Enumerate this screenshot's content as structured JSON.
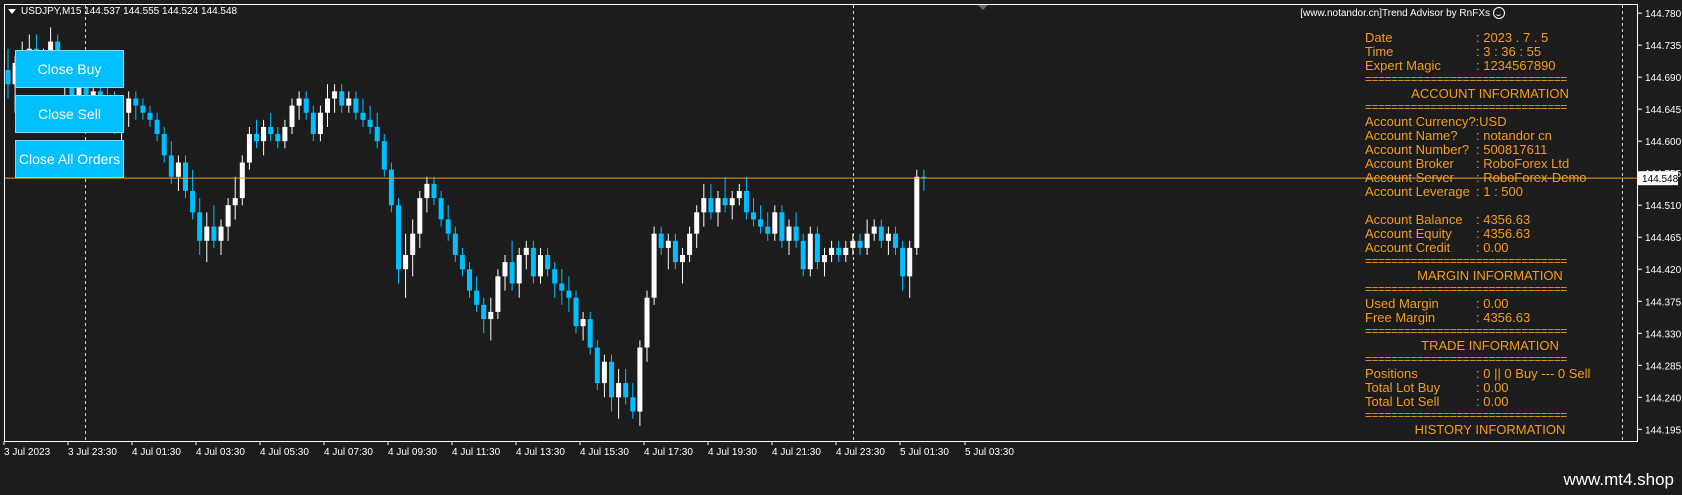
{
  "symbol_info": "USDJPY,M15  144.537 144.555 144.524 144.548",
  "ea_label": "[www.notandor.cn]Trend Advisor by RnFXs",
  "buttons": {
    "close_buy": "Close Buy",
    "close_sell": "Close Sell",
    "close_all": "Close All Orders"
  },
  "price_axis": [
    "144.780",
    "144.735",
    "144.690",
    "144.645",
    "144.600",
    "144.555",
    "144.510",
    "144.465",
    "144.420",
    "144.375",
    "144.330",
    "144.285",
    "144.240",
    "144.195"
  ],
  "current_price": "144.548",
  "time_axis": [
    "3 Jul 2023",
    "3 Jul 23:30",
    "4 Jul 01:30",
    "4 Jul 03:30",
    "4 Jul 05:30",
    "4 Jul 07:30",
    "4 Jul 09:30",
    "4 Jul 11:30",
    "4 Jul 13:30",
    "4 Jul 15:30",
    "4 Jul 17:30",
    "4 Jul 19:30",
    "4 Jul 21:30",
    "4 Jul 23:30",
    "5 Jul 01:30",
    "5 Jul 03:30"
  ],
  "panel": {
    "date_key": "Date",
    "date_val": ": 2023 . 7 . 5",
    "time_key": "Time",
    "time_val": ": 3 : 36 : 55",
    "magic_key": "Expert Magic",
    "magic_val": ": 1234567890",
    "separator": "===============================",
    "account_header": "ACCOUNT INFORMATION",
    "currency_key": "Account Currency?:",
    "currency_val": " USD",
    "name_key": "Account Name?",
    "name_val": ": notandor cn",
    "number_key": "Account Number?",
    "number_val": ": 500817611",
    "broker_key": "Account Broker",
    "broker_val": ": RoboForex Ltd",
    "server_key": "Account Server",
    "server_val": ": RoboForex-Demo",
    "leverage_key": "Account Leverage",
    "leverage_val": ": 1 : 500",
    "balance_key": "Account Balance",
    "balance_val": ": 4356.63",
    "equity_key": "Account Equity",
    "equity_val": ": 4356.63",
    "credit_key": "Account Credit",
    "credit_val": ": 0.00",
    "margin_header": "MARGIN INFORMATION",
    "used_margin_key": "Used Margin",
    "used_margin_val": ": 0.00",
    "free_margin_key": "Free Margin",
    "free_margin_val": ": 4356.63",
    "trade_header": "TRADE INFORMATION",
    "positions_key": "Positions",
    "positions_val": ": 0  ||  0 Buy --- 0 Sell",
    "lot_buy_key": "Total Lot Buy",
    "lot_buy_val": ": 0.00",
    "lot_sell_key": "Total Lot Sell",
    "lot_sell_val": ": 0.00",
    "history_header": "HISTORY INFORMATION"
  },
  "brand": "www.mt4.shop",
  "colors": {
    "background": "#1c1c1c",
    "bull": "#ffffff",
    "bear": "#00bfff",
    "price_line": "#f29c1f",
    "panel_text": "#f29c1f",
    "button": "#00bfff"
  },
  "chart_data": {
    "type": "candlestick",
    "y_range": [
      144.18,
      144.79
    ],
    "candles": [
      {
        "o": 144.7,
        "h": 144.73,
        "l": 144.66,
        "c": 144.68
      },
      {
        "o": 144.68,
        "h": 144.72,
        "l": 144.64,
        "c": 144.71
      },
      {
        "o": 144.71,
        "h": 144.74,
        "l": 144.68,
        "c": 144.72
      },
      {
        "o": 144.72,
        "h": 144.75,
        "l": 144.7,
        "c": 144.73
      },
      {
        "o": 144.73,
        "h": 144.75,
        "l": 144.69,
        "c": 144.7
      },
      {
        "o": 144.7,
        "h": 144.73,
        "l": 144.68,
        "c": 144.72
      },
      {
        "o": 144.72,
        "h": 144.76,
        "l": 144.7,
        "c": 144.74
      },
      {
        "o": 144.74,
        "h": 144.75,
        "l": 144.68,
        "c": 144.69
      },
      {
        "o": 144.69,
        "h": 144.72,
        "l": 144.66,
        "c": 144.7
      },
      {
        "o": 144.7,
        "h": 144.72,
        "l": 144.64,
        "c": 144.65
      },
      {
        "o": 144.65,
        "h": 144.7,
        "l": 144.63,
        "c": 144.68
      },
      {
        "o": 144.68,
        "h": 144.71,
        "l": 144.64,
        "c": 144.66
      },
      {
        "o": 144.66,
        "h": 144.69,
        "l": 144.64,
        "c": 144.67
      },
      {
        "o": 144.67,
        "h": 144.69,
        "l": 144.65,
        "c": 144.66
      },
      {
        "o": 144.66,
        "h": 144.68,
        "l": 144.63,
        "c": 144.65
      },
      {
        "o": 144.65,
        "h": 144.67,
        "l": 144.61,
        "c": 144.62
      },
      {
        "o": 144.62,
        "h": 144.66,
        "l": 144.6,
        "c": 144.64
      },
      {
        "o": 144.64,
        "h": 144.67,
        "l": 144.62,
        "c": 144.66
      },
      {
        "o": 144.66,
        "h": 144.67,
        "l": 144.63,
        "c": 144.65
      },
      {
        "o": 144.65,
        "h": 144.66,
        "l": 144.63,
        "c": 144.64
      },
      {
        "o": 144.64,
        "h": 144.65,
        "l": 144.62,
        "c": 144.63
      },
      {
        "o": 144.63,
        "h": 144.64,
        "l": 144.6,
        "c": 144.61
      },
      {
        "o": 144.61,
        "h": 144.62,
        "l": 144.57,
        "c": 144.58
      },
      {
        "o": 144.58,
        "h": 144.6,
        "l": 144.54,
        "c": 144.55
      },
      {
        "o": 144.55,
        "h": 144.58,
        "l": 144.53,
        "c": 144.57
      },
      {
        "o": 144.57,
        "h": 144.58,
        "l": 144.52,
        "c": 144.53
      },
      {
        "o": 144.53,
        "h": 144.56,
        "l": 144.49,
        "c": 144.5
      },
      {
        "o": 144.5,
        "h": 144.52,
        "l": 144.44,
        "c": 144.46
      },
      {
        "o": 144.46,
        "h": 144.5,
        "l": 144.43,
        "c": 144.48
      },
      {
        "o": 144.48,
        "h": 144.51,
        "l": 144.45,
        "c": 144.46
      },
      {
        "o": 144.46,
        "h": 144.49,
        "l": 144.44,
        "c": 144.48
      },
      {
        "o": 144.48,
        "h": 144.52,
        "l": 144.46,
        "c": 144.51
      },
      {
        "o": 144.51,
        "h": 144.55,
        "l": 144.49,
        "c": 144.52
      },
      {
        "o": 144.52,
        "h": 144.58,
        "l": 144.51,
        "c": 144.57
      },
      {
        "o": 144.57,
        "h": 144.62,
        "l": 144.56,
        "c": 144.61
      },
      {
        "o": 144.61,
        "h": 144.63,
        "l": 144.59,
        "c": 144.6
      },
      {
        "o": 144.6,
        "h": 144.63,
        "l": 144.58,
        "c": 144.62
      },
      {
        "o": 144.62,
        "h": 144.64,
        "l": 144.6,
        "c": 144.61
      },
      {
        "o": 144.61,
        "h": 144.62,
        "l": 144.59,
        "c": 144.6
      },
      {
        "o": 144.6,
        "h": 144.63,
        "l": 144.59,
        "c": 144.62
      },
      {
        "o": 144.62,
        "h": 144.66,
        "l": 144.61,
        "c": 144.65
      },
      {
        "o": 144.65,
        "h": 144.67,
        "l": 144.63,
        "c": 144.66
      },
      {
        "o": 144.66,
        "h": 144.67,
        "l": 144.63,
        "c": 144.64
      },
      {
        "o": 144.64,
        "h": 144.65,
        "l": 144.6,
        "c": 144.61
      },
      {
        "o": 144.61,
        "h": 144.65,
        "l": 144.6,
        "c": 144.64
      },
      {
        "o": 144.64,
        "h": 144.68,
        "l": 144.62,
        "c": 144.66
      },
      {
        "o": 144.66,
        "h": 144.68,
        "l": 144.64,
        "c": 144.67
      },
      {
        "o": 144.67,
        "h": 144.68,
        "l": 144.64,
        "c": 144.65
      },
      {
        "o": 144.65,
        "h": 144.67,
        "l": 144.64,
        "c": 144.66
      },
      {
        "o": 144.66,
        "h": 144.67,
        "l": 144.63,
        "c": 144.64
      },
      {
        "o": 144.64,
        "h": 144.66,
        "l": 144.62,
        "c": 144.63
      },
      {
        "o": 144.63,
        "h": 144.65,
        "l": 144.61,
        "c": 144.62
      },
      {
        "o": 144.62,
        "h": 144.64,
        "l": 144.59,
        "c": 144.6
      },
      {
        "o": 144.6,
        "h": 144.61,
        "l": 144.55,
        "c": 144.56
      },
      {
        "o": 144.56,
        "h": 144.57,
        "l": 144.5,
        "c": 144.51
      },
      {
        "o": 144.51,
        "h": 144.52,
        "l": 144.4,
        "c": 144.42
      },
      {
        "o": 144.42,
        "h": 144.47,
        "l": 144.38,
        "c": 144.44
      },
      {
        "o": 144.44,
        "h": 144.49,
        "l": 144.41,
        "c": 144.47
      },
      {
        "o": 144.47,
        "h": 144.53,
        "l": 144.45,
        "c": 144.52
      },
      {
        "o": 144.52,
        "h": 144.55,
        "l": 144.5,
        "c": 144.54
      },
      {
        "o": 144.54,
        "h": 144.55,
        "l": 144.51,
        "c": 144.52
      },
      {
        "o": 144.52,
        "h": 144.53,
        "l": 144.48,
        "c": 144.49
      },
      {
        "o": 144.49,
        "h": 144.51,
        "l": 144.46,
        "c": 144.47
      },
      {
        "o": 144.47,
        "h": 144.48,
        "l": 144.43,
        "c": 144.44
      },
      {
        "o": 144.44,
        "h": 144.45,
        "l": 144.41,
        "c": 144.42
      },
      {
        "o": 144.42,
        "h": 144.43,
        "l": 144.38,
        "c": 144.39
      },
      {
        "o": 144.39,
        "h": 144.41,
        "l": 144.36,
        "c": 144.37
      },
      {
        "o": 144.37,
        "h": 144.38,
        "l": 144.33,
        "c": 144.35
      },
      {
        "o": 144.35,
        "h": 144.38,
        "l": 144.32,
        "c": 144.36
      },
      {
        "o": 144.36,
        "h": 144.42,
        "l": 144.35,
        "c": 144.41
      },
      {
        "o": 144.41,
        "h": 144.44,
        "l": 144.39,
        "c": 144.43
      },
      {
        "o": 144.43,
        "h": 144.46,
        "l": 144.39,
        "c": 144.4
      },
      {
        "o": 144.4,
        "h": 144.45,
        "l": 144.38,
        "c": 144.44
      },
      {
        "o": 144.44,
        "h": 144.46,
        "l": 144.42,
        "c": 144.45
      },
      {
        "o": 144.45,
        "h": 144.46,
        "l": 144.4,
        "c": 144.41
      },
      {
        "o": 144.41,
        "h": 144.45,
        "l": 144.4,
        "c": 144.44
      },
      {
        "o": 144.44,
        "h": 144.45,
        "l": 144.41,
        "c": 144.42
      },
      {
        "o": 144.42,
        "h": 144.43,
        "l": 144.38,
        "c": 144.4
      },
      {
        "o": 144.4,
        "h": 144.42,
        "l": 144.37,
        "c": 144.39
      },
      {
        "o": 144.39,
        "h": 144.41,
        "l": 144.36,
        "c": 144.38
      },
      {
        "o": 144.38,
        "h": 144.39,
        "l": 144.33,
        "c": 144.34
      },
      {
        "o": 144.34,
        "h": 144.36,
        "l": 144.32,
        "c": 144.35
      },
      {
        "o": 144.35,
        "h": 144.36,
        "l": 144.3,
        "c": 144.31
      },
      {
        "o": 144.31,
        "h": 144.32,
        "l": 144.25,
        "c": 144.26
      },
      {
        "o": 144.26,
        "h": 144.3,
        "l": 144.24,
        "c": 144.29
      },
      {
        "o": 144.29,
        "h": 144.3,
        "l": 144.22,
        "c": 144.24
      },
      {
        "o": 144.24,
        "h": 144.28,
        "l": 144.21,
        "c": 144.26
      },
      {
        "o": 144.26,
        "h": 144.28,
        "l": 144.23,
        "c": 144.24
      },
      {
        "o": 144.24,
        "h": 144.26,
        "l": 144.21,
        "c": 144.22
      },
      {
        "o": 144.22,
        "h": 144.32,
        "l": 144.2,
        "c": 144.31
      },
      {
        "o": 144.31,
        "h": 144.39,
        "l": 144.29,
        "c": 144.38
      },
      {
        "o": 144.38,
        "h": 144.48,
        "l": 144.37,
        "c": 144.47
      },
      {
        "o": 144.47,
        "h": 144.48,
        "l": 144.44,
        "c": 144.45
      },
      {
        "o": 144.45,
        "h": 144.47,
        "l": 144.42,
        "c": 144.46
      },
      {
        "o": 144.46,
        "h": 144.47,
        "l": 144.42,
        "c": 144.43
      },
      {
        "o": 144.43,
        "h": 144.45,
        "l": 144.4,
        "c": 144.44
      },
      {
        "o": 144.44,
        "h": 144.48,
        "l": 144.43,
        "c": 144.47
      },
      {
        "o": 144.47,
        "h": 144.51,
        "l": 144.45,
        "c": 144.5
      },
      {
        "o": 144.5,
        "h": 144.54,
        "l": 144.48,
        "c": 144.52
      },
      {
        "o": 144.52,
        "h": 144.54,
        "l": 144.49,
        "c": 144.5
      },
      {
        "o": 144.5,
        "h": 144.53,
        "l": 144.48,
        "c": 144.52
      },
      {
        "o": 144.52,
        "h": 144.55,
        "l": 144.5,
        "c": 144.51
      },
      {
        "o": 144.51,
        "h": 144.53,
        "l": 144.49,
        "c": 144.52
      },
      {
        "o": 144.52,
        "h": 144.54,
        "l": 144.51,
        "c": 144.53
      },
      {
        "o": 144.53,
        "h": 144.55,
        "l": 144.49,
        "c": 144.5
      },
      {
        "o": 144.5,
        "h": 144.52,
        "l": 144.48,
        "c": 144.49
      },
      {
        "o": 144.49,
        "h": 144.51,
        "l": 144.47,
        "c": 144.48
      },
      {
        "o": 144.48,
        "h": 144.5,
        "l": 144.46,
        "c": 144.47
      },
      {
        "o": 144.47,
        "h": 144.51,
        "l": 144.46,
        "c": 144.5
      },
      {
        "o": 144.5,
        "h": 144.51,
        "l": 144.45,
        "c": 144.46
      },
      {
        "o": 144.46,
        "h": 144.49,
        "l": 144.44,
        "c": 144.48
      },
      {
        "o": 144.48,
        "h": 144.5,
        "l": 144.45,
        "c": 144.46
      },
      {
        "o": 144.46,
        "h": 144.47,
        "l": 144.41,
        "c": 144.42
      },
      {
        "o": 144.42,
        "h": 144.48,
        "l": 144.41,
        "c": 144.47
      },
      {
        "o": 144.47,
        "h": 144.48,
        "l": 144.42,
        "c": 144.43
      },
      {
        "o": 144.43,
        "h": 144.45,
        "l": 144.41,
        "c": 144.44
      },
      {
        "o": 144.44,
        "h": 144.46,
        "l": 144.43,
        "c": 144.45
      },
      {
        "o": 144.45,
        "h": 144.46,
        "l": 144.43,
        "c": 144.44
      },
      {
        "o": 144.44,
        "h": 144.46,
        "l": 144.43,
        "c": 144.45
      },
      {
        "o": 144.45,
        "h": 144.47,
        "l": 144.44,
        "c": 144.46
      },
      {
        "o": 144.46,
        "h": 144.47,
        "l": 144.44,
        "c": 144.45
      },
      {
        "o": 144.45,
        "h": 144.49,
        "l": 144.44,
        "c": 144.47
      },
      {
        "o": 144.47,
        "h": 144.49,
        "l": 144.46,
        "c": 144.48
      },
      {
        "o": 144.48,
        "h": 144.49,
        "l": 144.45,
        "c": 144.46
      },
      {
        "o": 144.46,
        "h": 144.48,
        "l": 144.44,
        "c": 144.47
      },
      {
        "o": 144.47,
        "h": 144.48,
        "l": 144.44,
        "c": 144.45
      },
      {
        "o": 144.45,
        "h": 144.46,
        "l": 144.39,
        "c": 144.41
      },
      {
        "o": 144.41,
        "h": 144.46,
        "l": 144.38,
        "c": 144.45
      },
      {
        "o": 144.45,
        "h": 144.56,
        "l": 144.44,
        "c": 144.55
      },
      {
        "o": 144.55,
        "h": 144.56,
        "l": 144.53,
        "c": 144.548
      }
    ]
  }
}
